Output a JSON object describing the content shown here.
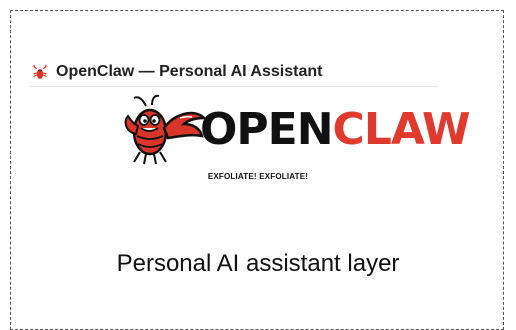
{
  "header": {
    "icon": "lobster-icon",
    "title": "OpenClaw — Personal AI Assistant"
  },
  "logo": {
    "mascot": "lobster-mascot-icon",
    "word_open": "OPEN",
    "word_claw": "CLAW",
    "colors": {
      "open": "#111111",
      "claw": "#e03a2f",
      "mascot": "#d9362b"
    }
  },
  "tagline": "EXFOLIATE! EXFOLIATE!",
  "subtitle": "Personal AI assistant layer"
}
